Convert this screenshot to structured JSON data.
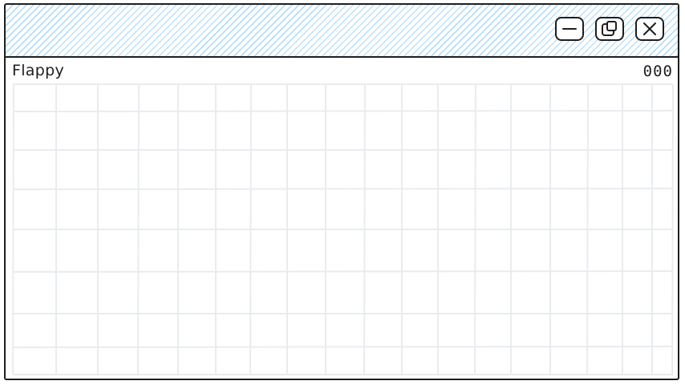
{
  "window": {
    "accent_color": "#a5d8ff",
    "border_color": "#1e1e1e",
    "controls": [
      {
        "name": "minimize",
        "icon": "minimize-icon"
      },
      {
        "name": "restore",
        "icon": "restore-icon"
      },
      {
        "name": "close",
        "icon": "close-icon"
      }
    ]
  },
  "game": {
    "title": "Flappy",
    "score": "000",
    "grid_color": "#e9ecef"
  }
}
